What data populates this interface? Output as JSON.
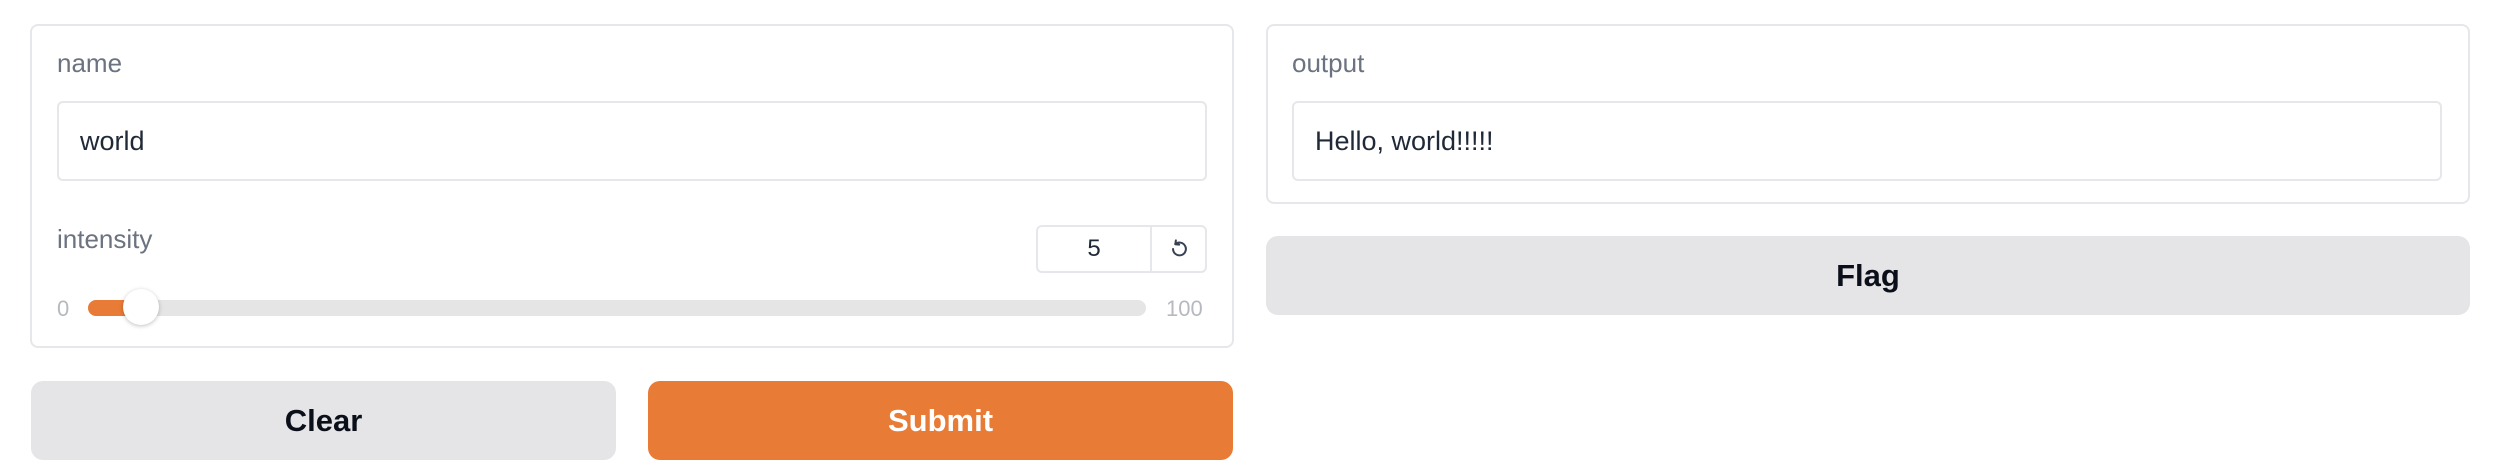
{
  "inputs": {
    "name": {
      "label": "name",
      "value": "world"
    },
    "intensity": {
      "label": "intensity",
      "value": "5",
      "min": "0",
      "max": "100",
      "fraction": 0.05,
      "reset_icon": "reset-icon"
    }
  },
  "outputs": {
    "output": {
      "label": "output",
      "value": "Hello, world!!!!!"
    }
  },
  "buttons": {
    "clear": "Clear",
    "submit": "Submit",
    "flag": "Flag"
  },
  "colors": {
    "accent": "#e87b35",
    "secondary_button": "#e5e5e7",
    "track": "#e5e5e5"
  }
}
